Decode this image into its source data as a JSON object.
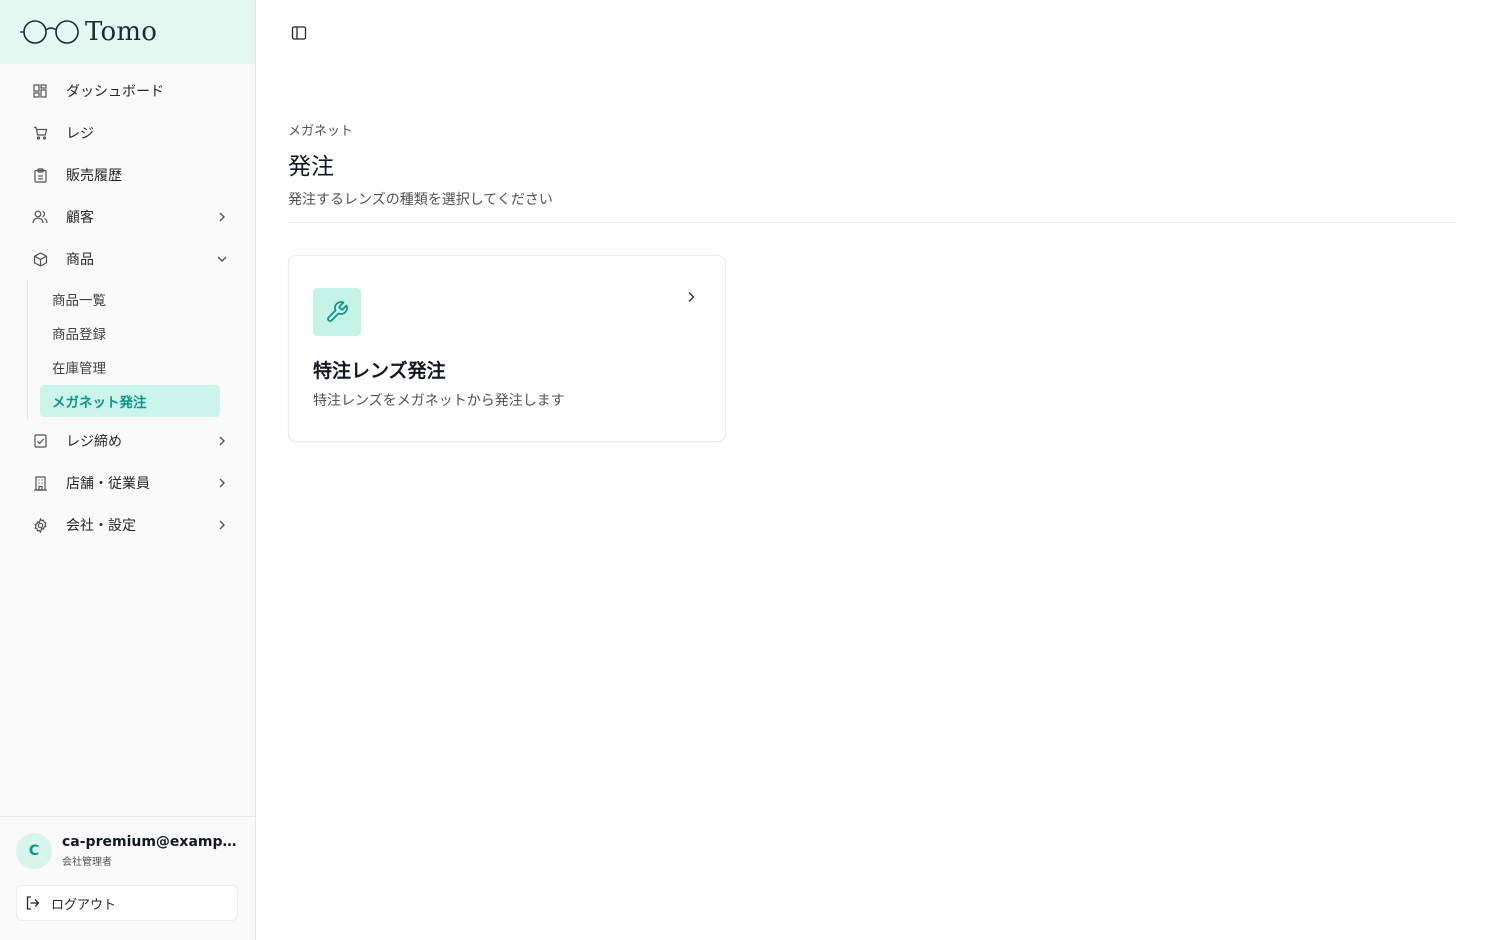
{
  "brand": {
    "name": "Tomo"
  },
  "nav": {
    "dashboard": "ダッシュボード",
    "register": "レジ",
    "sales_history": "販売履歴",
    "customers": "顧客",
    "products": "商品",
    "products_sub": {
      "list": "商品一覧",
      "register": "商品登録",
      "inventory": "在庫管理",
      "meganet_order": "メガネット発注"
    },
    "register_closing": "レジ締め",
    "stores_staff": "店舗・従業員",
    "company_settings": "会社・設定"
  },
  "user": {
    "initial": "C",
    "email": "ca-premium@example.com",
    "role": "会社管理者"
  },
  "logout": {
    "label": "ログアウト"
  },
  "page": {
    "breadcrumb": "メガネット",
    "title": "発注",
    "subtitle": "発注するレンズの種類を選択してください"
  },
  "card": {
    "title": "特注レンズ発注",
    "description": "特注レンズをメガネットから発注します"
  },
  "colors": {
    "accent": "#0d9488",
    "accent_bg": "#ccf5ea",
    "brand_bg": "#e3f8f1"
  }
}
